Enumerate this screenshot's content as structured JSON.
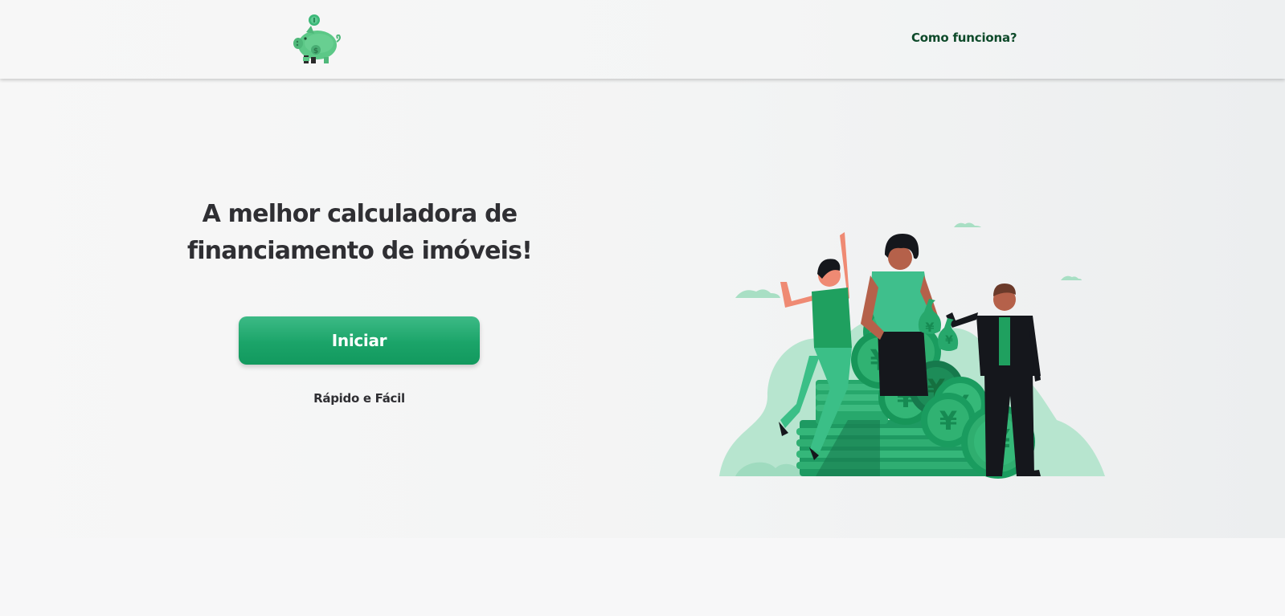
{
  "header": {
    "logo_name": "piggy-bank-logo",
    "nav": {
      "how_it_works": "Como funciona?"
    }
  },
  "hero": {
    "title": "A melhor calculadora de financiamento de imóveis!",
    "start_button": "Iniciar",
    "subtitle": "Rápido e Fácil",
    "illustration_name": "people-celebrating-money-illustration"
  },
  "colors": {
    "brand_green": "#1ba469",
    "dark_green_text": "#0e4a2a",
    "light_green": "#b6e4cf",
    "text_dark": "#2f2f33"
  }
}
